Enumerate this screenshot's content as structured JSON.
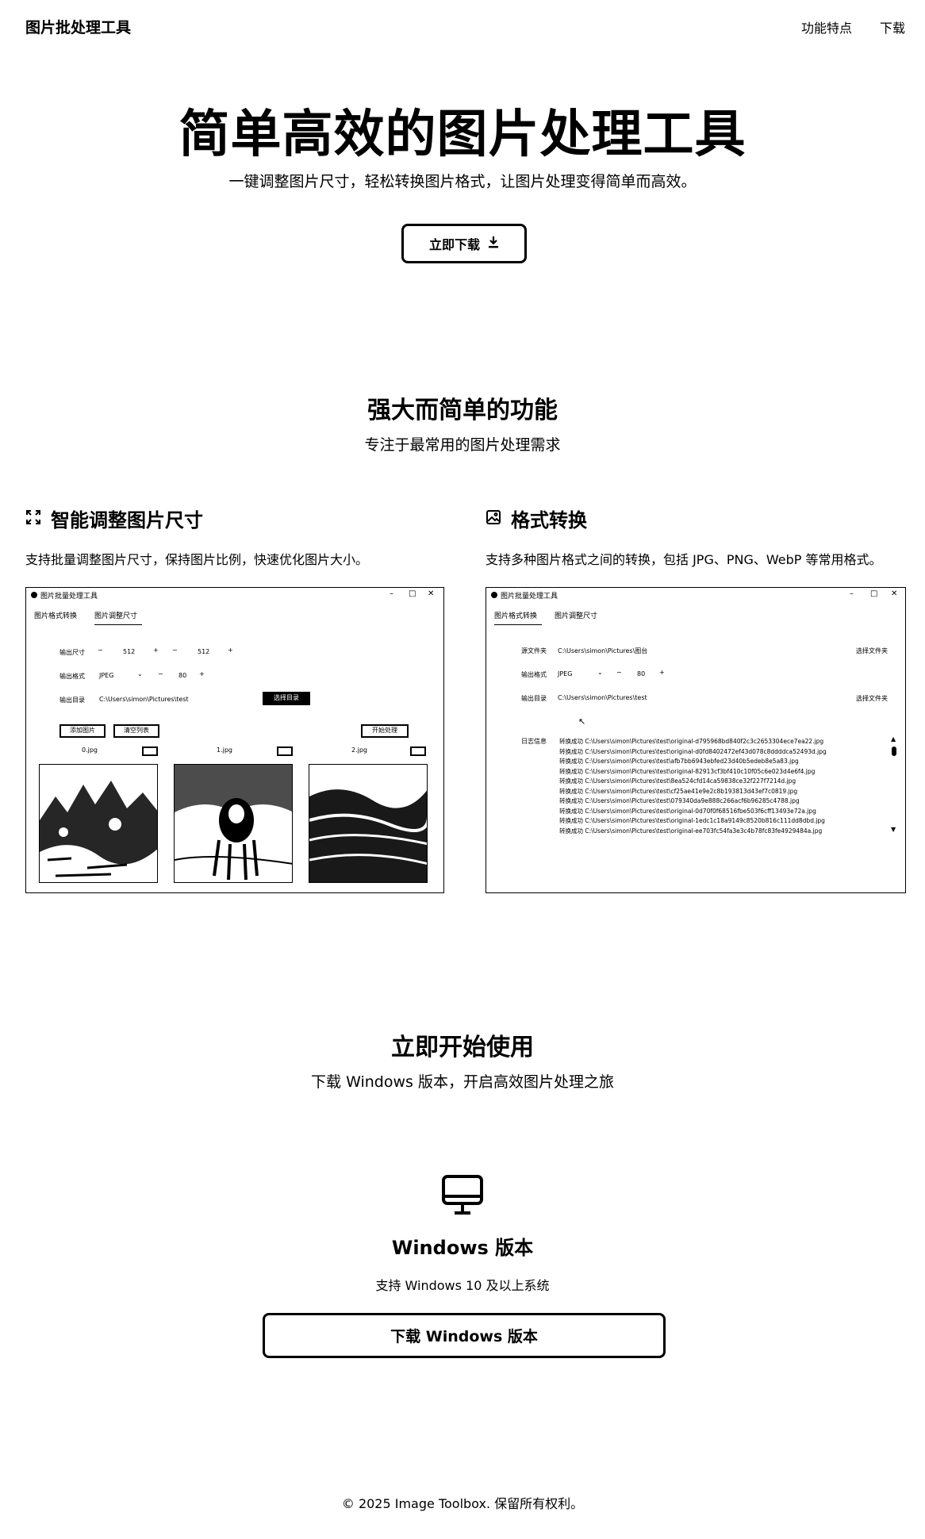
{
  "nav": {
    "brand": "图片批处理工具",
    "features_link": "功能特点",
    "download_link": "下载"
  },
  "hero": {
    "title": "简单高效的图片处理工具",
    "subtitle": "一键调整图片尺寸，轻松转换图片格式，让图片处理变得简单而高效。",
    "cta_label": "立即下载",
    "cta_icon": "download-icon"
  },
  "features": {
    "title": "强大而简单的功能",
    "subtitle": "专注于最常用的图片处理需求",
    "resize": {
      "icon": "expand-icon",
      "title": "智能调整图片尺寸",
      "desc": "支持批量调整图片尺寸，保持图片比例，快速优化图片大小。",
      "screenshot": {
        "window_title": "图片批量处理工具",
        "tabs": [
          "图片格式转换",
          "图片调整尺寸"
        ],
        "size_label": "输出尺寸",
        "width_value": "512",
        "height_value": "512",
        "format_label": "输出格式",
        "format_value": "JPEG",
        "quality_value": "80",
        "dir_label": "输出目录",
        "dir_value": "C:\\Users\\simon\\Pictures\\test",
        "browse_label": "选择目录",
        "add_label": "添加图片",
        "clear_label": "清空列表",
        "start_label": "开始处理",
        "images": [
          "0.jpg",
          "1.jpg",
          "2.jpg"
        ]
      }
    },
    "convert": {
      "icon": "image-icon",
      "title": "格式转换",
      "desc": "支持多种图片格式之间的转换，包括 JPG、PNG、WebP 等常用格式。",
      "screenshot": {
        "window_title": "图片批量处理工具",
        "tabs": [
          "图片格式转换",
          "图片调整尺寸"
        ],
        "src_label": "源文件夹",
        "src_value": "C:\\Users\\simon\\Pictures\\图台",
        "src_btn": "选择文件夹",
        "format_label": "输出格式",
        "format_value": "JPEG",
        "quality_value": "80",
        "dir_label": "输出目录",
        "dir_value": "C:\\Users\\simon\\Pictures\\test",
        "dir_btn": "选择文件夹",
        "log_label": "日志信息",
        "log_lines": [
          "转换成功 C:\\Users\\simon\\Pictures\\test\\original-d795968bd840f2c3c2653304ece7ea22.jpg",
          "转换成功 C:\\Users\\simon\\Pictures\\test\\original-d0fd8402472ef43d078c8ddddca52493d.jpg",
          "转换成功 C:\\Users\\simon\\Pictures\\test\\afb7bb6943ebfed23d40b5edeb8e5a83.jpg",
          "转换成功 C:\\Users\\simon\\Pictures\\test\\original-82913cf3bf410c10f05c6e023d4e6f4.jpg",
          "转换成功 C:\\Users\\simon\\Pictures\\test\\8ea524cfd14ca59838ce32f227f7214d.jpg",
          "转换成功 C:\\Users\\simon\\Pictures\\test\\cf25ae41e9e2c8b193813d43ef7c0819.jpg",
          "转换成功 C:\\Users\\simon\\Pictures\\test\\079340da9e888c266acf6b96285c4788.jpg",
          "转换成功 C:\\Users\\simon\\Pictures\\test\\original-0d70f0f68516fbe503f6cff13493e72a.jpg",
          "转换成功 C:\\Users\\simon\\Pictures\\test\\original-1edc1c18a9149c8520b816c111dd8dbd.jpg",
          "转换成功 C:\\Users\\simon\\Pictures\\test\\original-ee703fc54fa3e3c4b78fc83fe4929484a.jpg"
        ]
      }
    }
  },
  "start": {
    "title": "立即开始使用",
    "subtitle": "下载 Windows 版本，开启高效图片处理之旅"
  },
  "download": {
    "icon": "monitor-icon",
    "title": "Windows 版本",
    "subtitle": "支持 Windows 10 及以上系统",
    "button_label": "下载 Windows 版本"
  },
  "footer": {
    "copyright": "© 2025 Image Toolbox. 保留所有权利。"
  }
}
